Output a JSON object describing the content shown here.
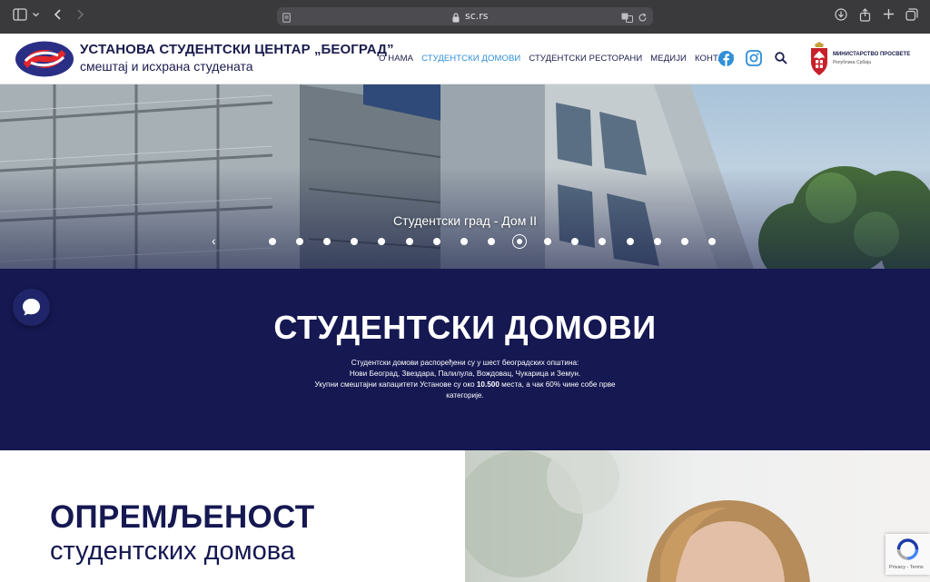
{
  "browser": {
    "url": "sc.rs"
  },
  "header": {
    "brand_title": "УСТАНОВА СТУДЕНТСКИ ЦЕНТАР „БЕОГРАД”",
    "brand_subtitle": "смештај и исхрана студената",
    "nav": [
      {
        "label": "О НАМА",
        "active": false
      },
      {
        "label": "СТУДЕНТСКИ ДОМОВИ",
        "active": true
      },
      {
        "label": "СТУДЕНТСКИ РЕСТОРАНИ",
        "active": false
      },
      {
        "label": "МЕДИЈИ",
        "active": false
      },
      {
        "label": "КОНТАКТ",
        "active": false
      }
    ],
    "ministry_title": "МИНИСТАРСТВО ПРОСВЕТЕ",
    "ministry_subtitle": "Република Србија"
  },
  "hero": {
    "caption": "Студентски град - Дом II",
    "slide_count": 17,
    "active_slide": 10
  },
  "section": {
    "title": "СТУДЕНТСКИ ДОМОВИ",
    "desc_line1": "Студентски домови распоређени су у шест београдских општина:",
    "desc_line2": "Нови Београд, Звездара, Палилула, Вождовац, Чукарица и Земун.",
    "desc_line3_pre": "Укупни смештајни капацитети Установе су око ",
    "desc_line3_bold": "10.500",
    "desc_line3_post": " места, а чак 60% чине собе прве",
    "desc_line4": "категорије."
  },
  "lower": {
    "title": "ОПРЕМЉЕНОСТ",
    "subtitle": "студентских домова"
  },
  "recaptcha": {
    "links": "Privacy - Terms"
  },
  "colors": {
    "navy": "#151851",
    "accent_blue": "#2f8fd8",
    "brand_red": "#e3262c"
  }
}
